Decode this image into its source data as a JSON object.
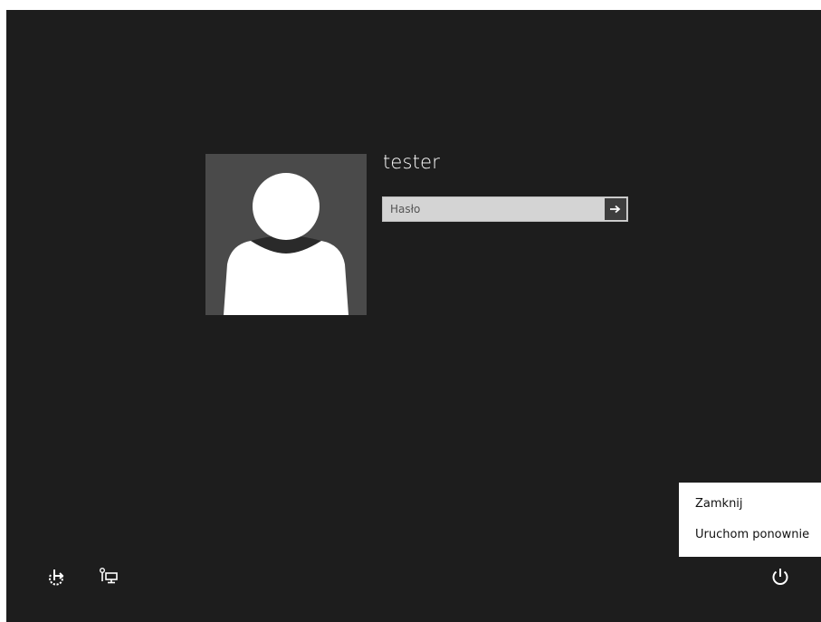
{
  "login": {
    "username": "tester",
    "password_placeholder": "Hasło",
    "password_value": ""
  },
  "power_menu": {
    "items": [
      {
        "label": "Zamknij"
      },
      {
        "label": "Uruchom ponownie"
      }
    ]
  },
  "icons": {
    "ease_of_access": "ease-of-access-icon",
    "network": "network-icon",
    "power": "power-icon",
    "submit": "arrow-right-icon",
    "avatar": "user-silhouette-icon"
  },
  "colors": {
    "background": "#1d1d1d",
    "avatar_tile": "#4a4a4a",
    "text": "#ffffff",
    "input_bg": "#d4d4d4",
    "menu_bg": "#ffffff"
  }
}
